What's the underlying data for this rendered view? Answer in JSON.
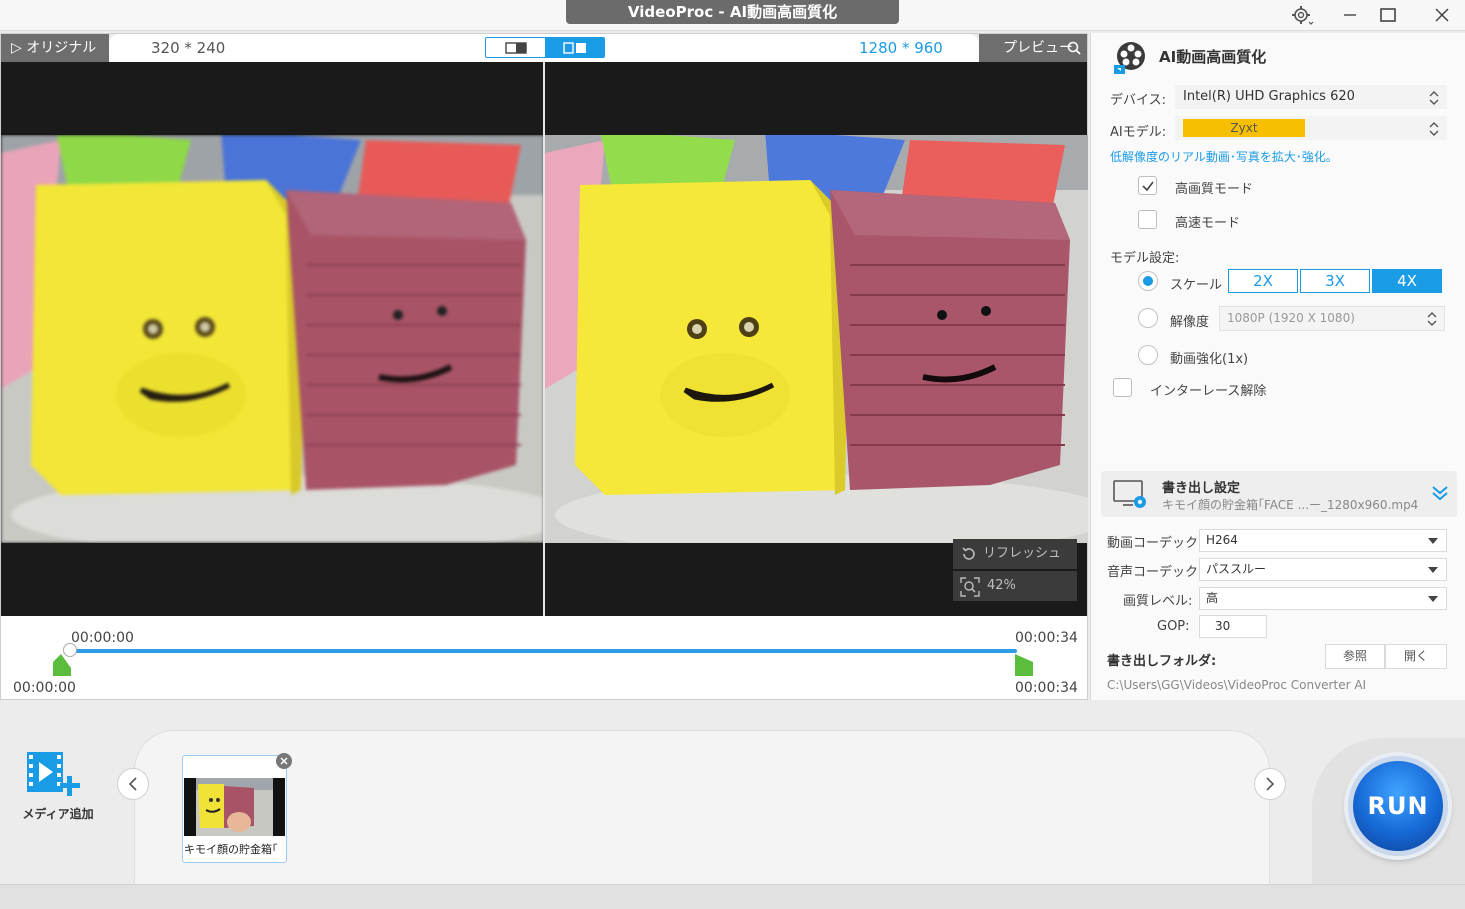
{
  "window": {
    "title": "VideoProc -  AI動画高画質化"
  },
  "preview": {
    "original_tab": "オリジナル",
    "original_resolution": "320 * 240",
    "output_resolution": "1280 * 960",
    "preview_tab": "プレビュー",
    "refresh_label": "リフレッシュ",
    "zoom_label": "42%"
  },
  "timeline": {
    "current_top": "00:00:00",
    "end_top": "00:00:34",
    "start_bottom": "00:00:00",
    "end_bottom": "00:00:34",
    "progress": 1.0
  },
  "panel": {
    "title": "AI動画高画質化",
    "device_label": "デバイス:",
    "device_value": "Intel(R) UHD Graphics 620",
    "model_label": "AIモデル:",
    "model_value": "Zyxt",
    "model_desc": "低解像度のリアル動画･写真を拡大･強化。",
    "high_quality_mode": "高画質モード",
    "high_quality_checked": true,
    "fast_mode": "高速モード",
    "fast_checked": false,
    "model_settings_label": "モデル設定:",
    "scale_label": "スケール",
    "scale_options": [
      "2X",
      "3X",
      "4X"
    ],
    "scale_selected": "4X",
    "resolution_label": "解像度",
    "resolution_value": "1080P (1920 X 1080)",
    "enhance_label": "動画強化(1x)",
    "deinterlace_label": "インターレース解除"
  },
  "export": {
    "title": "書き出し設定",
    "filename": "キモイ顔の貯金箱｢FACE ...ー_1280x960.mp4",
    "video_codec_label": "動画コーデック:",
    "video_codec": "H264",
    "audio_codec_label": "音声コーデック:",
    "audio_codec": "パススルー",
    "quality_label": "画質レベル:",
    "quality": "高",
    "gop_label": "GOP:",
    "gop": "30",
    "folder_label": "書き出しフォルダ:",
    "browse": "参照",
    "open": "開く",
    "folder_path": "C:\\Users\\GG\\Videos\\VideoProc Converter AI"
  },
  "bottom": {
    "media_add": "メディア追加",
    "thumb_label": "キモイ顔の貯金箱｢",
    "run": "RUN"
  },
  "colors": {
    "accent": "#1a9be6",
    "model_chip": "#f6c000",
    "dark_tab": "#6e6e6e"
  }
}
